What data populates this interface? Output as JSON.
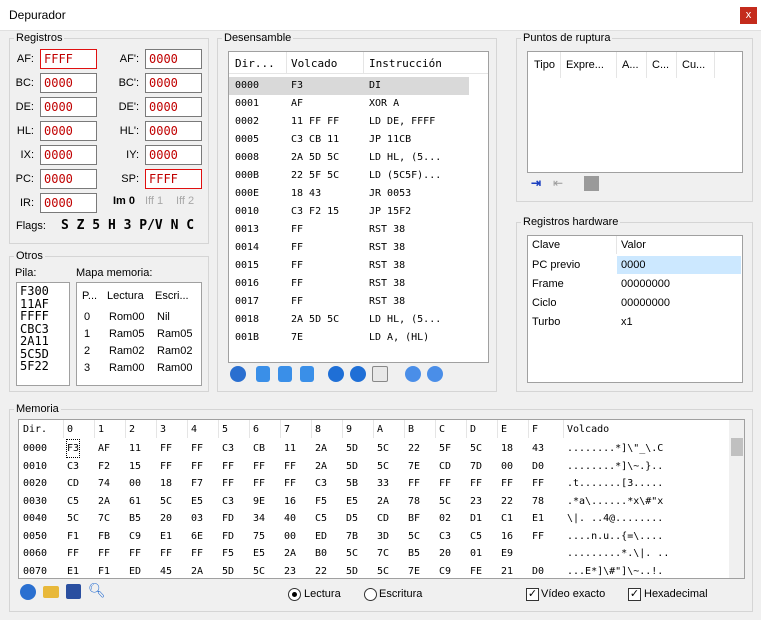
{
  "window": {
    "title": "Depurador",
    "close": "x"
  },
  "registros": {
    "title": "Registros",
    "left": [
      {
        "label": "AF:",
        "value": "FFFF",
        "hl": true
      },
      {
        "label": "BC:",
        "value": "0000"
      },
      {
        "label": "DE:",
        "value": "0000"
      },
      {
        "label": "HL:",
        "value": "0000"
      },
      {
        "label": "IX:",
        "value": "0000"
      },
      {
        "label": "PC:",
        "value": "0000"
      },
      {
        "label": "IR:",
        "value": "0000"
      }
    ],
    "right": [
      {
        "label": "AF':",
        "value": "0000"
      },
      {
        "label": "BC':",
        "value": "0000"
      },
      {
        "label": "DE':",
        "value": "0000"
      },
      {
        "label": "HL':",
        "value": "0000"
      },
      {
        "label": "IY:",
        "value": "0000"
      },
      {
        "label": "SP:",
        "value": "FFFF",
        "hl": true
      }
    ],
    "im": "Im 0",
    "iff1": "Iff 1",
    "iff2": "Iff 2",
    "flags_label": "Flags:",
    "flags": "S Z 5 H 3 P/V N C"
  },
  "otros": {
    "title": "Otros",
    "pila_label": "Pila:",
    "pila": [
      "F300",
      "11AF",
      "FFFF",
      "CBC3",
      "2A11",
      "5C5D",
      "5F22"
    ],
    "mapa_label": "Mapa memoria:",
    "mapa_cols": [
      "P...",
      "Lectura",
      "Escri..."
    ],
    "mapa_rows": [
      [
        "0",
        "Rom00",
        "Nil"
      ],
      [
        "1",
        "Ram05",
        "Ram05"
      ],
      [
        "2",
        "Ram02",
        "Ram02"
      ],
      [
        "3",
        "Ram00",
        "Ram00"
      ]
    ]
  },
  "desensamble": {
    "title": "Desensamble",
    "cols": [
      "Dir...",
      "Volcado",
      "Instrucción"
    ],
    "rows": [
      [
        "0000",
        "F3",
        "DI"
      ],
      [
        "0001",
        "AF",
        "XOR A"
      ],
      [
        "0002",
        "11 FF FF",
        "LD DE, FFFF"
      ],
      [
        "0005",
        "C3 CB 11",
        "JP 11CB"
      ],
      [
        "0008",
        "2A 5D 5C",
        "LD HL, (5..."
      ],
      [
        "000B",
        "22 5F 5C",
        "LD (5C5F)..."
      ],
      [
        "000E",
        "18 43",
        "JR 0053"
      ],
      [
        "0010",
        "C3 F2 15",
        "JP 15F2"
      ],
      [
        "0013",
        "FF",
        "RST 38"
      ],
      [
        "0014",
        "FF",
        "RST 38"
      ],
      [
        "0015",
        "FF",
        "RST 38"
      ],
      [
        "0016",
        "FF",
        "RST 38"
      ],
      [
        "0017",
        "FF",
        "RST 38"
      ],
      [
        "0018",
        "2A 5D 5C",
        "LD HL, (5..."
      ],
      [
        "001B",
        "7E",
        "LD A, (HL)"
      ]
    ]
  },
  "puntos": {
    "title": "Puntos de ruptura",
    "cols": [
      "Tipo",
      "Expre...",
      "A...",
      "C...",
      "Cu..."
    ]
  },
  "hardware": {
    "title": "Registros hardware",
    "cols": [
      "Clave",
      "Valor"
    ],
    "rows": [
      [
        "PC previo",
        "0000"
      ],
      [
        "Frame",
        "00000000"
      ],
      [
        "Ciclo",
        "00000000"
      ],
      [
        "Turbo",
        "x1"
      ]
    ]
  },
  "memoria": {
    "title": "Memoria",
    "cols": [
      "Dir.",
      "0",
      "1",
      "2",
      "3",
      "4",
      "5",
      "6",
      "7",
      "8",
      "9",
      "A",
      "B",
      "C",
      "D",
      "E",
      "F",
      "Volcado"
    ],
    "rows": [
      [
        "0000",
        "F3",
        "AF",
        "11",
        "FF",
        "FF",
        "C3",
        "CB",
        "11",
        "2A",
        "5D",
        "5C",
        "22",
        "5F",
        "5C",
        "18",
        "43",
        "........*]\\\"_\\.C"
      ],
      [
        "0010",
        "C3",
        "F2",
        "15",
        "FF",
        "FF",
        "FF",
        "FF",
        "FF",
        "2A",
        "5D",
        "5C",
        "7E",
        "CD",
        "7D",
        "00",
        "D0",
        "........*]\\~.}.."
      ],
      [
        "0020",
        "CD",
        "74",
        "00",
        "18",
        "F7",
        "FF",
        "FF",
        "FF",
        "C3",
        "5B",
        "33",
        "FF",
        "FF",
        "FF",
        "FF",
        "FF",
        ".t.......[3....."
      ],
      [
        "0030",
        "C5",
        "2A",
        "61",
        "5C",
        "E5",
        "C3",
        "9E",
        "16",
        "F5",
        "E5",
        "2A",
        "78",
        "5C",
        "23",
        "22",
        "78",
        ".*a\\......*x\\#\"x"
      ],
      [
        "0040",
        "5C",
        "7C",
        "B5",
        "20",
        "03",
        "FD",
        "34",
        "40",
        "C5",
        "D5",
        "CD",
        "BF",
        "02",
        "D1",
        "C1",
        "E1",
        "\\|. ..4@........"
      ],
      [
        "0050",
        "F1",
        "FB",
        "C9",
        "E1",
        "6E",
        "FD",
        "75",
        "00",
        "ED",
        "7B",
        "3D",
        "5C",
        "C3",
        "C5",
        "16",
        "FF",
        "....n.u..{=\\...."
      ],
      [
        "0060",
        "FF",
        "FF",
        "FF",
        "FF",
        "FF",
        "F5",
        "E5",
        "2A",
        "B0",
        "5C",
        "7C",
        "B5",
        "20",
        "01",
        "E9",
        "",
        ".........*.\\|. .."
      ],
      [
        "0070",
        "E1",
        "F1",
        "ED",
        "45",
        "2A",
        "5D",
        "5C",
        "23",
        "22",
        "5D",
        "5C",
        "7E",
        "C9",
        "FE",
        "21",
        "D0",
        "...E*]\\#\"]\\~..!."
      ]
    ],
    "lectura": "Lectura",
    "escritura": "Escritura",
    "video": "Vídeo exacto",
    "hex": "Hexadecimal"
  },
  "colors": {
    "highlight": "#cce8ff",
    "selected": "#d9d9d9",
    "reg_text": "#c00000",
    "close": "#c42b1c"
  }
}
